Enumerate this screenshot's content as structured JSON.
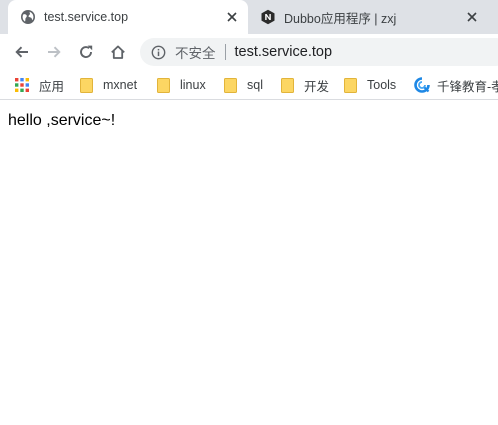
{
  "tabs": [
    {
      "title": "test.service.top",
      "active": true,
      "favicon": "globe-icon"
    },
    {
      "title": "Dubbo应用程序 | zxj",
      "active": false,
      "favicon": "n-logo-icon"
    }
  ],
  "toolbar": {
    "security_label": "不安全",
    "url": "test.service.top"
  },
  "bookmarks": {
    "apps_label": "应用",
    "items": [
      {
        "label": "mxnet",
        "icon": "folder-icon"
      },
      {
        "label": "linux",
        "icon": "folder-icon"
      },
      {
        "label": "sql",
        "icon": "folder-icon"
      },
      {
        "label": "开发",
        "icon": "folder-icon"
      },
      {
        "label": "Tools",
        "icon": "folder-icon"
      },
      {
        "label": "千锋教育-孝",
        "icon": "qianfeng-logo-icon"
      }
    ]
  },
  "page": {
    "body_text": "hello ,service~!"
  },
  "colors": {
    "tabstrip_bg": "#dee1e6",
    "omnibox_bg": "#f1f3f4",
    "folder_yellow": "#fcd663",
    "icon_gray": "#5f6368"
  }
}
